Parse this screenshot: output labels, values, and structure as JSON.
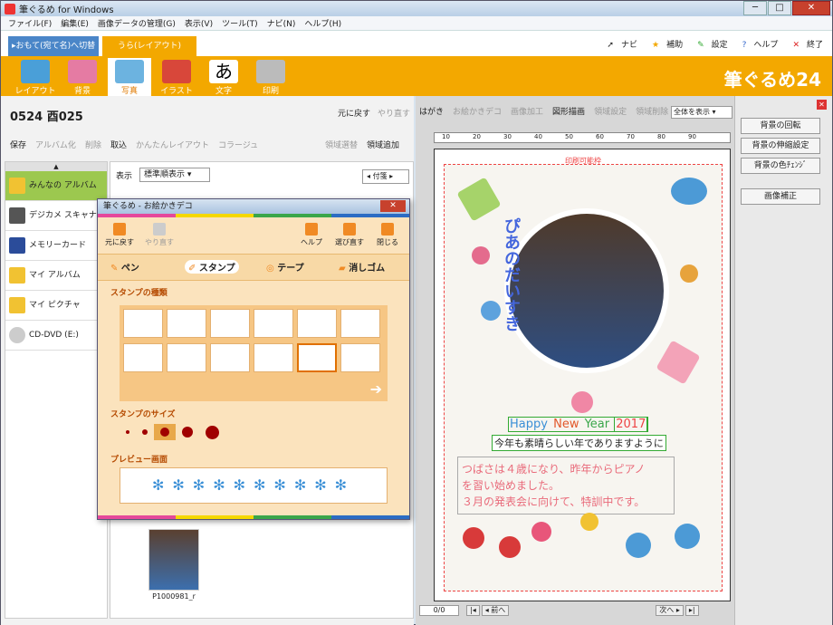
{
  "window": {
    "title": "筆ぐるめ for Windows",
    "min": "─",
    "max": "□",
    "close": "✕"
  },
  "menu": [
    "ファイル(F)",
    "編集(E)",
    "画像データの管理(G)",
    "表示(V)",
    "ツール(T)",
    "ナビ(N)",
    "ヘルプ(H)"
  ],
  "tabs": {
    "front": "▸おもて(宛て名)へ切替",
    "back": "うら(レイアウト)"
  },
  "topright": [
    "ナビ",
    "補助",
    "設定",
    "ヘルプ",
    "終了"
  ],
  "ribbon": {
    "items": [
      "レイアウト",
      "背景",
      "写真",
      "イラスト",
      "文字",
      "印刷"
    ],
    "brand": "筆ぐるめ24"
  },
  "left": {
    "filename": "0524 酉025",
    "undo": "元に戻す",
    "redo": "やり直す",
    "toolbar": [
      "保存",
      "アルバム化",
      "削除",
      "取込",
      "かんたんレイアウト",
      "コラージュ"
    ],
    "toolbar_right": [
      "領域選替",
      "領域追加"
    ],
    "display_label": "表示",
    "display_value": "標準順表示",
    "sort_value": "付箋",
    "sidebar": [
      "みんなの アルバム",
      "デジカメ スキャナー",
      "メモリーカード",
      "マイ アルバム",
      "マイ ピクチャ",
      "CD-DVD (E:)"
    ],
    "thumb_caption": "P1000981_r"
  },
  "right": {
    "toolbar": [
      "はがき",
      "お絵かきデコ",
      "画像加工",
      "図形描画",
      "領域設定",
      "領域削除"
    ],
    "zoom": "全体を表示",
    "print_label": "印刷可能枠",
    "vertical_text": "ぴあのだいすき",
    "hny": [
      "Happy",
      "New",
      "Year",
      "2017"
    ],
    "line2": "今年も素晴らしい年でありますように",
    "message": [
      "つばさは４歳になり、昨年からピアノ",
      "を習い始めました。",
      "３月の発表会に向けて、特訓中です。"
    ],
    "page": "0/0",
    "prev": "前へ",
    "next": "次へ",
    "ruler": [
      "10",
      "20",
      "30",
      "40",
      "50",
      "60",
      "70",
      "80",
      "90"
    ]
  },
  "side": {
    "buttons": [
      "背景の回転",
      "背景の伸縮設定",
      "背景の色ﾁｪﾝｼﾞ",
      "画像補正"
    ],
    "close": "✕"
  },
  "dialog": {
    "title": "筆ぐるめ - お絵かきデコ",
    "close": "✕",
    "buttons": [
      "元に戻す",
      "やり直す",
      "ヘルプ",
      "選び直す",
      "閉じる"
    ],
    "tools": [
      "ペン",
      "スタンプ",
      "テープ",
      "消しゴム"
    ],
    "stamp_types_label": "スタンプの種類",
    "stamp_size_label": "スタンプのサイズ",
    "preview_label": "プレビュー画面",
    "preview_text": "✻✻✻✻✻✻✻✻✻✻"
  }
}
